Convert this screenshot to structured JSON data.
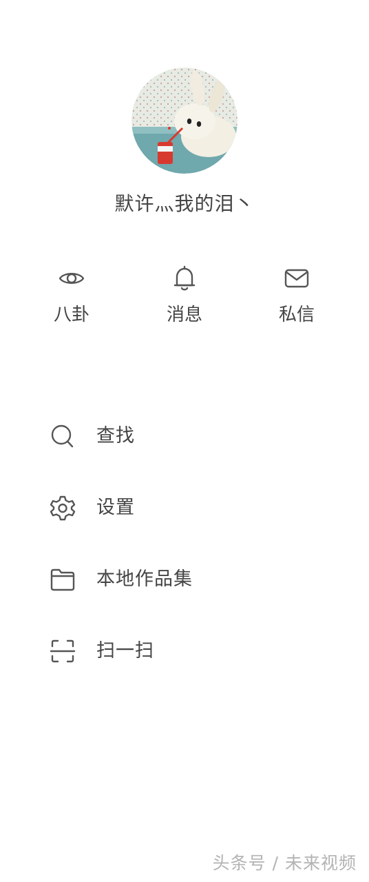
{
  "profile": {
    "username": "默许灬我的泪丶"
  },
  "quick_actions": [
    {
      "label": "八卦",
      "icon": "eye-icon"
    },
    {
      "label": "消息",
      "icon": "bell-icon"
    },
    {
      "label": "私信",
      "icon": "mail-icon"
    }
  ],
  "menu": [
    {
      "label": "查找",
      "icon": "search-icon"
    },
    {
      "label": "设置",
      "icon": "gear-icon"
    },
    {
      "label": "本地作品集",
      "icon": "folder-icon"
    },
    {
      "label": "扫一扫",
      "icon": "scan-icon"
    }
  ],
  "watermark": "头条号 / 未来视频"
}
